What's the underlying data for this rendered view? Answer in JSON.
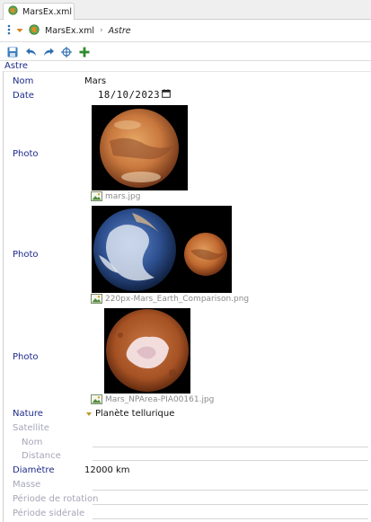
{
  "tab": {
    "title": "MarsEx.xml"
  },
  "breadcrumb": {
    "file": "MarsEx.xml",
    "separator": "›",
    "element": "Astre"
  },
  "root": {
    "label": "Astre"
  },
  "fields": {
    "nom": {
      "label": "Nom",
      "value": "Mars"
    },
    "date": {
      "label": "Date",
      "value": "18/10/2023"
    },
    "photos": [
      {
        "label": "Photo",
        "file": "mars.jpg"
      },
      {
        "label": "Photo",
        "file": "220px-Mars_Earth_Comparison.png"
      },
      {
        "label": "Photo",
        "file": "Mars_NPArea-PIA00161.jpg"
      }
    ],
    "nature": {
      "label": "Nature",
      "value": "Planète tellurique"
    },
    "satellite": {
      "label": "Satellite",
      "nom_label": "Nom",
      "distance_label": "Distance"
    },
    "diametre": {
      "label": "Diamètre",
      "value": "12000 km"
    },
    "masse": {
      "label": "Masse"
    },
    "periode_rotation": {
      "label": "Période de rotation"
    },
    "periode_siderale": {
      "label": "Période sidérale"
    }
  },
  "colors": {
    "label": "#1e2a8a",
    "label_disabled": "#a6a6b8",
    "accent_orange": "#d5821e",
    "add_green": "#2e8b2e",
    "blue_icons": "#2f6fb0"
  }
}
